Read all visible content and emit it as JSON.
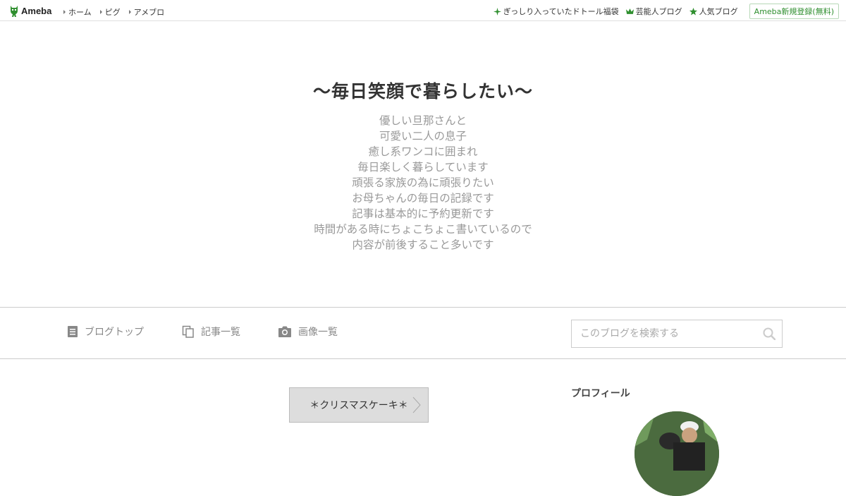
{
  "topbar": {
    "logo_text": "Ameba",
    "nav": [
      "ホーム",
      "ピグ",
      "アメブロ"
    ],
    "right_links": [
      "ぎっしり入っていたドトール福袋",
      "芸能人ブログ",
      "人気ブログ"
    ],
    "signup_label": "Ameba新規登録(無料)"
  },
  "header": {
    "title": "〜毎日笑顔で暮らしたい〜",
    "description": [
      "優しい旦那さんと",
      "可愛い二人の息子",
      "癒し系ワンコに囲まれ",
      "毎日楽しく暮らしています",
      "頑張る家族の為に頑張りたい",
      "お母ちゃんの毎日の記録です",
      "記事は基本的に予約更新です",
      "時間がある時にちょこちょこ書いているので",
      "内容が前後すること多いです"
    ]
  },
  "blognav": {
    "items": [
      "ブログトップ",
      "記事一覧",
      "画像一覧"
    ],
    "search_placeholder": "このブログを検索する"
  },
  "main": {
    "entry_link": "＊クリスマスケーキ＊"
  },
  "sidebar": {
    "profile_title": "プロフィール"
  },
  "colors": {
    "ameba_green": "#2f8f2f",
    "muted_text": "#999999"
  }
}
